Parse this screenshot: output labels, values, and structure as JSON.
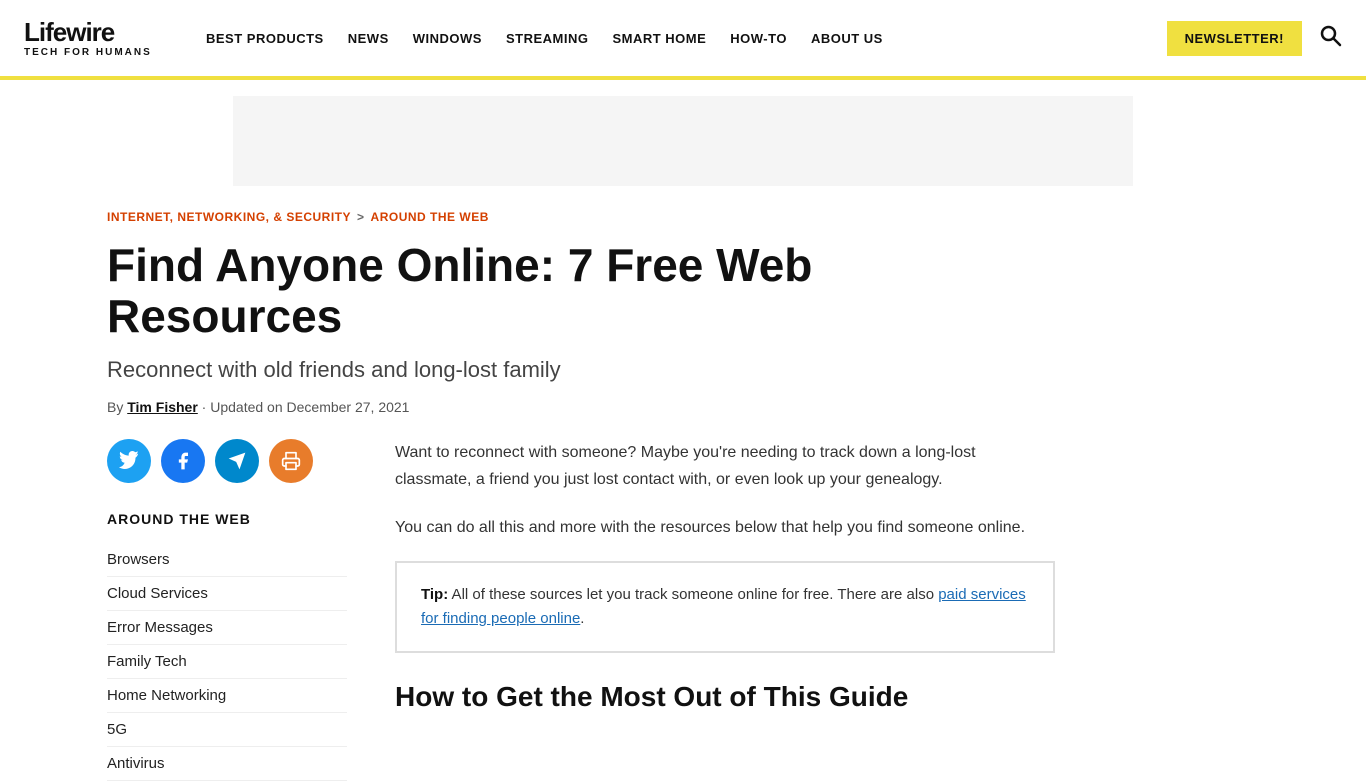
{
  "header": {
    "logo_text": "Lifewire",
    "logo_tagline": "TECH FOR HUMANS",
    "nav_items": [
      {
        "label": "BEST PRODUCTS",
        "id": "best-products"
      },
      {
        "label": "NEWS",
        "id": "news"
      },
      {
        "label": "WINDOWS",
        "id": "windows"
      },
      {
        "label": "STREAMING",
        "id": "streaming"
      },
      {
        "label": "SMART HOME",
        "id": "smart-home"
      },
      {
        "label": "HOW-TO",
        "id": "how-to"
      },
      {
        "label": "ABOUT US",
        "id": "about-us"
      }
    ],
    "newsletter_label": "NEWSLETTER!",
    "search_icon": "🔍"
  },
  "breadcrumb": {
    "parent_label": "INTERNET, NETWORKING, & SECURITY",
    "separator": ">",
    "current_label": "AROUND THE WEB"
  },
  "article": {
    "title": "Find Anyone Online: 7 Free Web Resources",
    "subtitle": "Reconnect with old friends and long-lost family",
    "meta_by": "By",
    "meta_author": "Tim Fisher",
    "meta_updated": "· Updated on December 27, 2021"
  },
  "social": {
    "twitter_label": "Twitter",
    "facebook_label": "Facebook",
    "telegram_label": "Telegram",
    "print_label": "Print"
  },
  "sidebar": {
    "section_title": "AROUND THE WEB",
    "nav_items": [
      {
        "label": "Browsers"
      },
      {
        "label": "Cloud Services"
      },
      {
        "label": "Error Messages"
      },
      {
        "label": "Family Tech"
      },
      {
        "label": "Home Networking"
      },
      {
        "label": "5G"
      },
      {
        "label": "Antivirus"
      }
    ]
  },
  "main": {
    "intro_p1": "Want to reconnect with someone? Maybe you're needing to track down a long-lost classmate, a friend you just lost contact with, or even look up your genealogy.",
    "intro_p2": "You can do all this and more with the resources below that help you find someone online.",
    "tip_label": "Tip:",
    "tip_text": " All of these sources let you track someone online for free. There are also ",
    "tip_link": "paid services for finding people online",
    "tip_end": ".",
    "section_heading": "How to Get the Most Out of This Guide"
  },
  "colors": {
    "accent_yellow": "#f0e040",
    "brand_red": "#d44000",
    "link_blue": "#1a6bb5"
  }
}
